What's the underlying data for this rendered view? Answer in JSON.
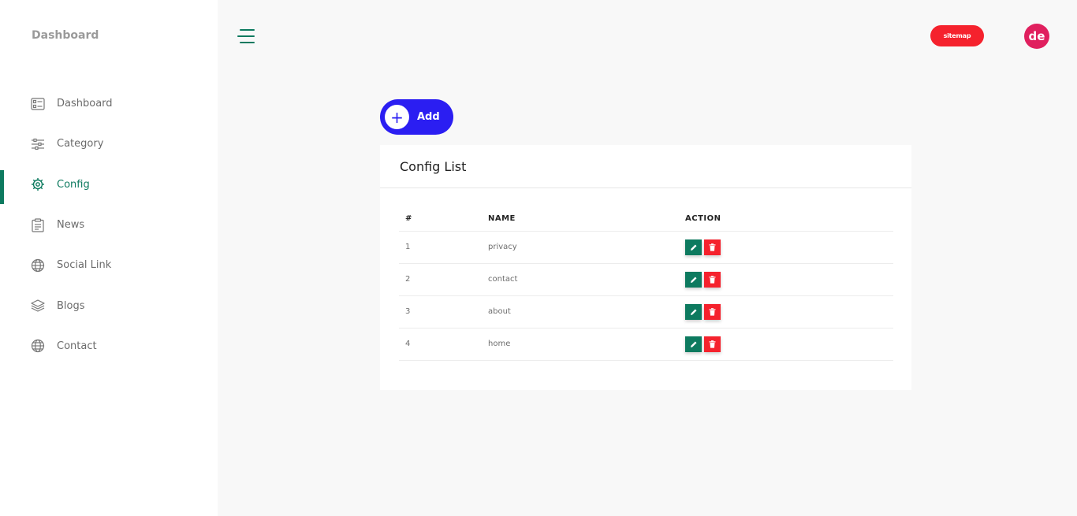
{
  "sidebar": {
    "brand": "Dashboard",
    "items": [
      {
        "label": "Dashboard",
        "icon": "dashboard-icon",
        "active": false
      },
      {
        "label": "Category",
        "icon": "sliders-icon",
        "active": false
      },
      {
        "label": "Config",
        "icon": "gear-icon",
        "active": true
      },
      {
        "label": "News",
        "icon": "clipboard-icon",
        "active": false
      },
      {
        "label": "Social Link",
        "icon": "globe-icon",
        "active": false
      },
      {
        "label": "Blogs",
        "icon": "layers-icon",
        "active": false
      },
      {
        "label": "Contact",
        "icon": "globe-icon",
        "active": false
      }
    ]
  },
  "header": {
    "sitemap_label": "sitemap",
    "avatar_initials": "de"
  },
  "main": {
    "add_label": "Add",
    "card_title": "Config List",
    "columns": [
      "#",
      "NAME",
      "ACTION"
    ],
    "rows": [
      {
        "num": "1",
        "name": "privacy"
      },
      {
        "num": "2",
        "name": "contact"
      },
      {
        "num": "3",
        "name": "about"
      },
      {
        "num": "4",
        "name": "home"
      }
    ]
  },
  "colors": {
    "accent": "#0d7a5f",
    "primary_button": "#2b1ef2",
    "danger": "#f5222d",
    "avatar": "#e01f5e"
  }
}
